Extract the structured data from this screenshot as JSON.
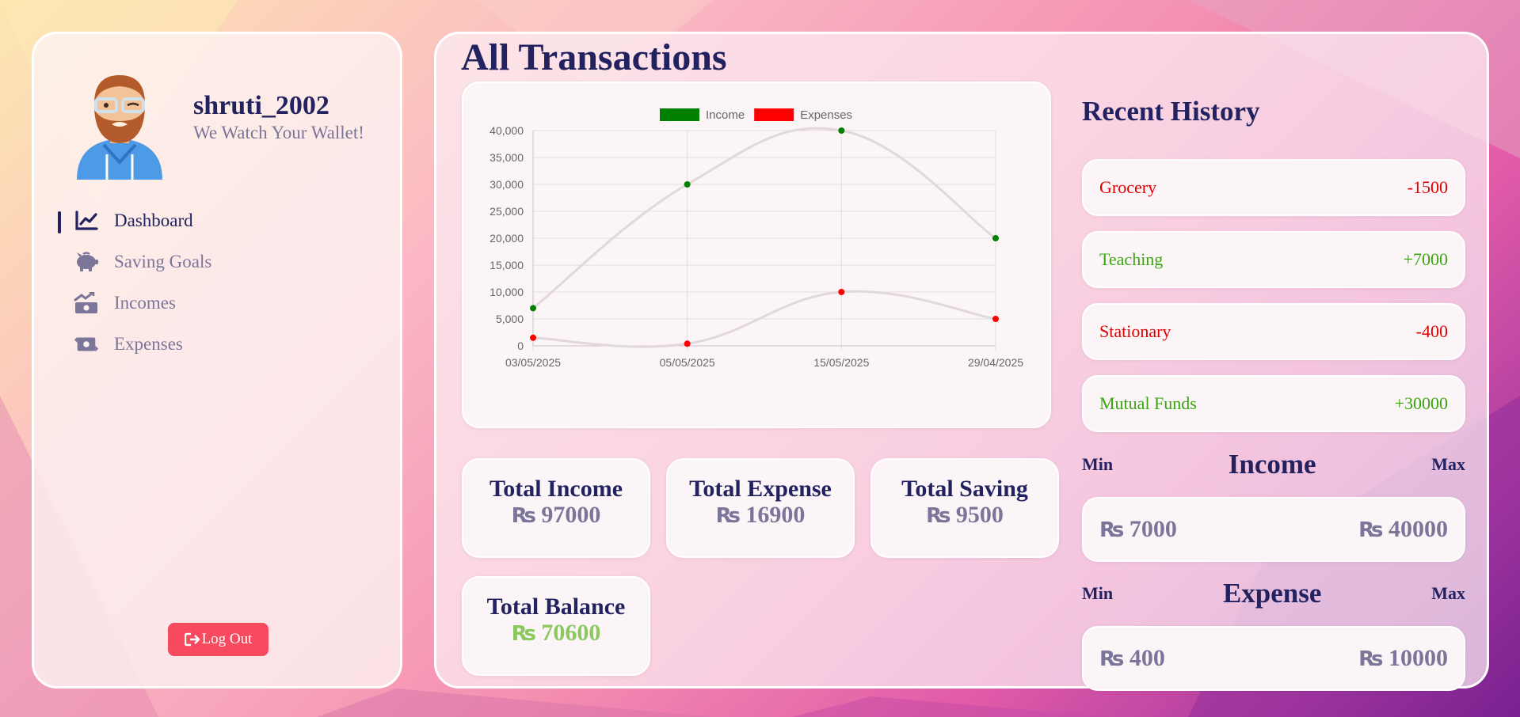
{
  "profile": {
    "username": "shruti_2002",
    "tagline": "We Watch Your Wallet!"
  },
  "nav": {
    "items": [
      {
        "label": "Dashboard",
        "icon": "chart-line-icon",
        "active": true
      },
      {
        "label": "Saving Goals",
        "icon": "piggy-bank-icon",
        "active": false
      },
      {
        "label": "Incomes",
        "icon": "money-bill-trend-up-icon",
        "active": false
      },
      {
        "label": "Expenses",
        "icon": "money-bill-transfer-icon",
        "active": false
      }
    ]
  },
  "logout_label": "Log Out",
  "page_title": "All Transactions",
  "chart_data": {
    "type": "line",
    "categories": [
      "03/05/2025",
      "05/05/2025",
      "15/05/2025",
      "29/04/2025"
    ],
    "series": [
      {
        "name": "Income",
        "values": [
          7000,
          30000,
          40000,
          20000
        ],
        "color": "#008000"
      },
      {
        "name": "Expenses",
        "values": [
          1500,
          400,
          10000,
          5000
        ],
        "color": "#ff0000"
      }
    ],
    "ylim": [
      0,
      40000
    ],
    "yticks": [
      "40,000",
      "35,000",
      "30,000",
      "25,000",
      "20,000",
      "15,000",
      "10,000",
      "5,000",
      "0"
    ],
    "legend": "top",
    "grid": true,
    "line_color": "#e0d8da"
  },
  "stats": {
    "total_income": {
      "title": "Total Income",
      "currency": "₨",
      "amount": "97000"
    },
    "total_expense": {
      "title": "Total Expense",
      "currency": "₨",
      "amount": "16900"
    },
    "total_saving": {
      "title": "Total Saving",
      "currency": "₨",
      "amount": "9500"
    },
    "total_balance": {
      "title": "Total Balance",
      "currency": "₨",
      "amount": "70600"
    }
  },
  "history": {
    "title": "Recent History",
    "items": [
      {
        "name": "Grocery",
        "amount": "-1500",
        "color": "#e00000"
      },
      {
        "name": "Teaching",
        "amount": "+7000",
        "color": "#3aa60e"
      },
      {
        "name": "Stationary",
        "amount": "-400",
        "color": "#e00000"
      },
      {
        "name": "Mutual Funds",
        "amount": "+30000",
        "color": "#3aa60e"
      }
    ]
  },
  "income_range": {
    "min_label": "Min",
    "title": "Income",
    "max_label": "Max",
    "currency": "₨",
    "min": "7000",
    "max": "40000"
  },
  "expense_range": {
    "min_label": "Min",
    "title": "Expense",
    "max_label": "Max",
    "currency": "₨",
    "min": "400",
    "max": "10000"
  },
  "colors": {
    "navy": "#222260",
    "muted": "#7b7699",
    "logout": "#f74a5e",
    "balance": "#8cc860"
  }
}
